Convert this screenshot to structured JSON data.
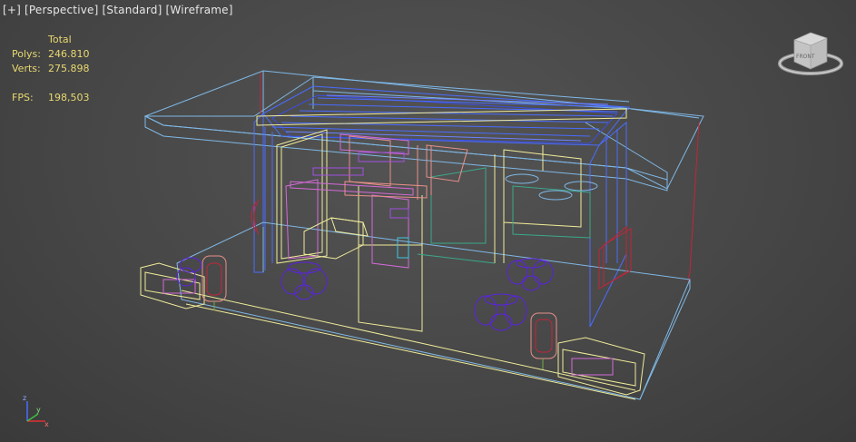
{
  "viewport": {
    "label_parts": [
      "[+]",
      "[Perspective]",
      "[Standard]",
      "[Wireframe]"
    ]
  },
  "stats": {
    "header": "Total",
    "rows": [
      {
        "label": "Polys:",
        "value": "246.810"
      },
      {
        "label": "Verts:",
        "value": "275.898"
      },
      {
        "label": "FPS:",
        "value": "198,503"
      }
    ]
  },
  "viewcube": {
    "face_label": "FRONT"
  },
  "axis": {
    "z": "z",
    "x": "x",
    "y": "y"
  },
  "colors": {
    "background": "#474747",
    "stats_text": "#e8d870",
    "label_text": "#e6e6e6",
    "wire_blue": "#4a6cff",
    "wire_cyan": "#7fb8e6",
    "wire_yellow": "#f0ec9a",
    "wire_magenta": "#d36ad8",
    "wire_purple": "#5a22e0",
    "wire_red": "#c2263a",
    "wire_pink": "#e8908a"
  }
}
